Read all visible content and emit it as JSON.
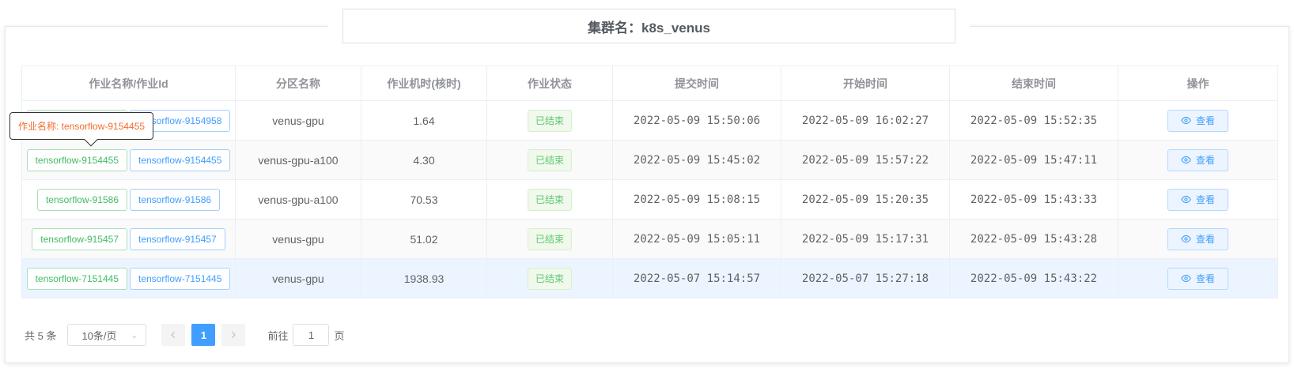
{
  "header": {
    "cluster_title": "集群名：k8s_venus"
  },
  "tooltip": {
    "text": "作业名称: tensorflow-9154455"
  },
  "table": {
    "columns": [
      "作业名称/作业Id",
      "分区名称",
      "作业机时(核时)",
      "作业状态",
      "提交时间",
      "开始时间",
      "结束时间",
      "操作"
    ],
    "rows": [
      {
        "job_name": "tensorflow-9154958",
        "job_id": "tensorflow-9154958",
        "partition": "venus-gpu",
        "core_hours": "1.64",
        "status": "已结束",
        "submit": "2022-05-09 15:50:06",
        "start": "2022-05-09 16:02:27",
        "end": "2022-05-09 15:52:35",
        "action": "查看"
      },
      {
        "job_name": "tensorflow-9154455",
        "job_id": "tensorflow-9154455",
        "partition": "venus-gpu-a100",
        "core_hours": "4.30",
        "status": "已结束",
        "submit": "2022-05-09 15:45:02",
        "start": "2022-05-09 15:57:22",
        "end": "2022-05-09 15:47:11",
        "action": "查看"
      },
      {
        "job_name": "tensorflow-91586",
        "job_id": "tensorflow-91586",
        "partition": "venus-gpu-a100",
        "core_hours": "70.53",
        "status": "已结束",
        "submit": "2022-05-09 15:08:15",
        "start": "2022-05-09 15:20:35",
        "end": "2022-05-09 15:43:33",
        "action": "查看"
      },
      {
        "job_name": "tensorflow-915457",
        "job_id": "tensorflow-915457",
        "partition": "venus-gpu",
        "core_hours": "51.02",
        "status": "已结束",
        "submit": "2022-05-09 15:05:11",
        "start": "2022-05-09 15:17:31",
        "end": "2022-05-09 15:43:28",
        "action": "查看"
      },
      {
        "job_name": "tensorflow-7151445",
        "job_id": "tensorflow-7151445",
        "partition": "venus-gpu",
        "core_hours": "1938.93",
        "status": "已结束",
        "submit": "2022-05-07 15:14:57",
        "start": "2022-05-07 15:27:18",
        "end": "2022-05-09 15:43:22",
        "action": "查看"
      }
    ]
  },
  "pagination": {
    "total": "共 5 条",
    "page_size": "10条/页",
    "current_page": "1",
    "jump_prefix": "前往",
    "jump_value": "1",
    "jump_suffix": "页"
  },
  "icons": {
    "view": "eye-icon",
    "prev": "chevron-left-icon",
    "next": "chevron-right-icon",
    "dropdown": "chevron-down-icon"
  },
  "colors": {
    "primary": "#409eff",
    "success": "#3ebd63",
    "tooltip_text": "#f56c2d"
  }
}
